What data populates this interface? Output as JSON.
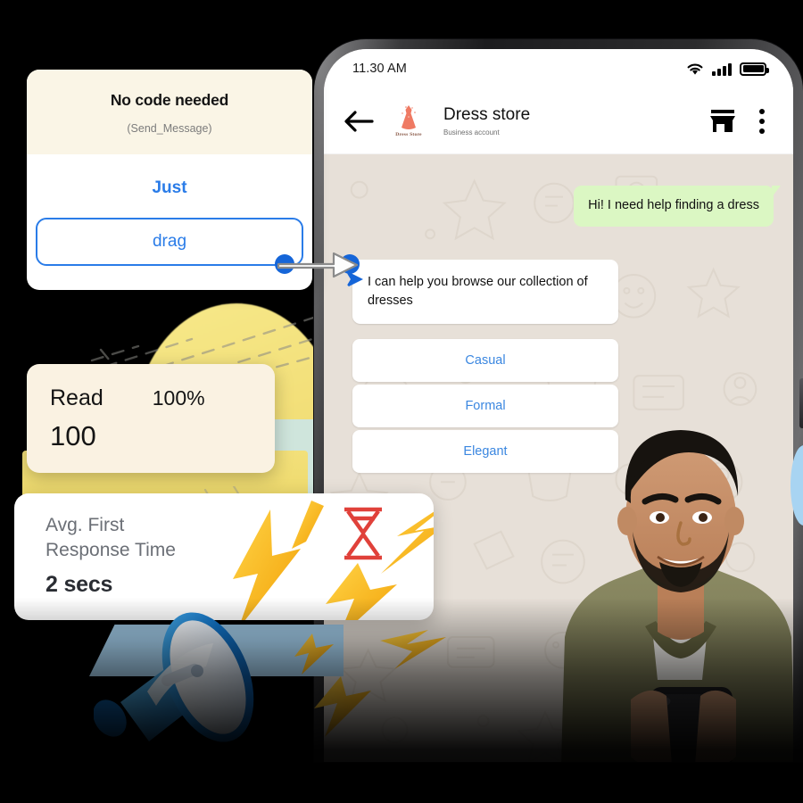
{
  "background_color": "#000000",
  "accent_blue": "#2a7ce8",
  "code_card": {
    "title": "No code needed",
    "subtitle": "(Send_Message)",
    "just_label": "Just",
    "drag_label": "drag"
  },
  "read_card": {
    "label": "Read",
    "percent": "100%",
    "value": "100"
  },
  "response_card": {
    "label_line1": "Avg. First",
    "label_line2": "Response Time",
    "value": "2 secs",
    "icon": "hourglass-icon"
  },
  "phone": {
    "status_bar": {
      "time": "11.30 AM",
      "wifi_icon": "wifi-icon",
      "signal_icon": "signal-bars-icon",
      "battery_icon": "battery-icon"
    },
    "chat_header": {
      "back_icon": "back-arrow-icon",
      "avatar_label": "Dress Store",
      "title": "Dress store",
      "subtitle": "Business account",
      "shop_icon": "storefront-icon",
      "menu_icon": "kebab-menu-icon"
    },
    "messages": [
      {
        "direction": "outgoing",
        "text": "Hi! I need help finding a dress"
      },
      {
        "direction": "incoming",
        "text": "I can help you browse our collection of dresses"
      }
    ],
    "quick_replies": [
      {
        "label": "Casual"
      },
      {
        "label": "Formal"
      },
      {
        "label": "Elegant"
      }
    ],
    "person_photo": "man-holding-phone-photo"
  },
  "decorations": {
    "megaphone": "megaphone-3d-icon",
    "lightning": "lightning-bolt-icon",
    "drag_handle_start": "drag-handle-dot",
    "drag_handle_end": "drop-target-dot",
    "drag_arrow": "drag-arrow-icon"
  }
}
